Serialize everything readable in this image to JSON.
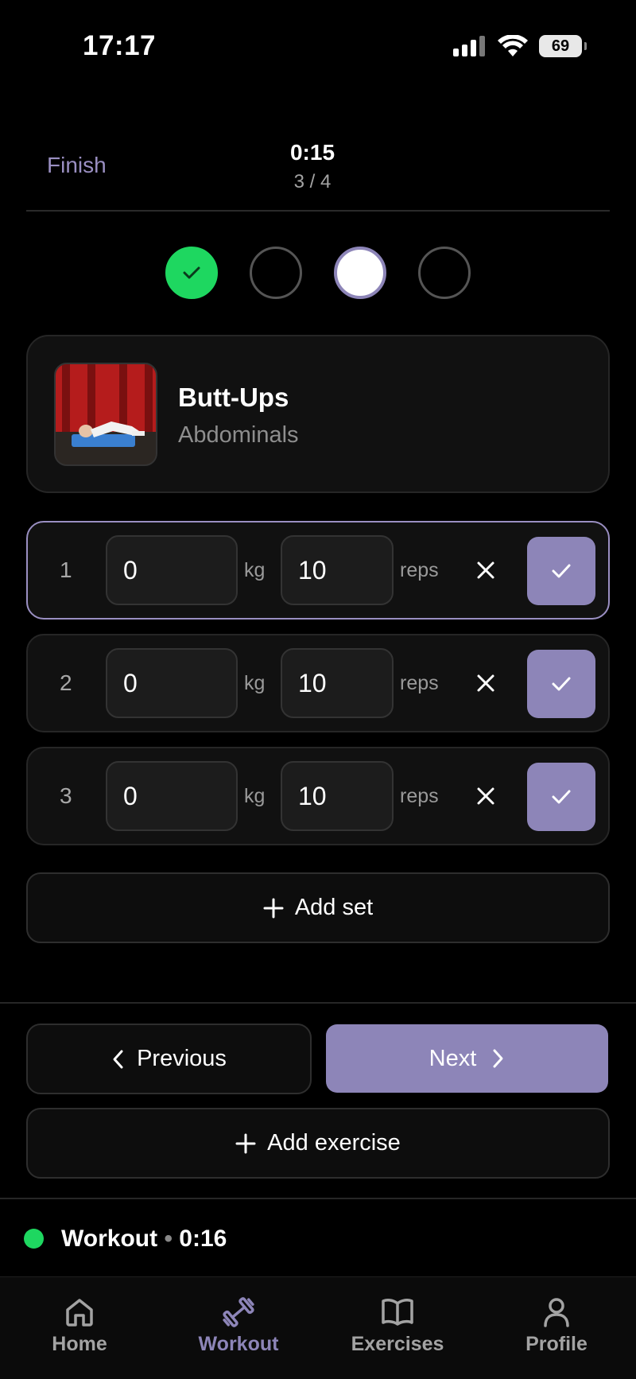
{
  "status_bar": {
    "time": "17:17",
    "battery": "69"
  },
  "header": {
    "finish_label": "Finish",
    "timer": "0:15",
    "progress": "3 / 4"
  },
  "steps": [
    {
      "state": "done"
    },
    {
      "state": "pending"
    },
    {
      "state": "current"
    },
    {
      "state": "pending"
    }
  ],
  "exercise": {
    "name": "Butt-Ups",
    "muscle": "Abdominals"
  },
  "sets": [
    {
      "number": "1",
      "weight": "0",
      "weight_unit": "kg",
      "reps": "10",
      "reps_unit": "reps",
      "active": true
    },
    {
      "number": "2",
      "weight": "0",
      "weight_unit": "kg",
      "reps": "10",
      "reps_unit": "reps",
      "active": false
    },
    {
      "number": "3",
      "weight": "0",
      "weight_unit": "kg",
      "reps": "10",
      "reps_unit": "reps",
      "active": false
    }
  ],
  "actions": {
    "add_set": "Add set",
    "previous": "Previous",
    "next": "Next",
    "add_exercise": "Add exercise"
  },
  "workout_status": {
    "label": "Workout",
    "elapsed": "0:16"
  },
  "tabs": [
    {
      "label": "Home",
      "icon": "home-icon",
      "active": false
    },
    {
      "label": "Workout",
      "icon": "dumbbell-icon",
      "active": true
    },
    {
      "label": "Exercises",
      "icon": "book-icon",
      "active": false
    },
    {
      "label": "Profile",
      "icon": "user-icon",
      "active": false
    }
  ],
  "colors": {
    "accent": "#8d85b8",
    "success": "#1ed760",
    "background": "#000000",
    "card": "#111111"
  }
}
